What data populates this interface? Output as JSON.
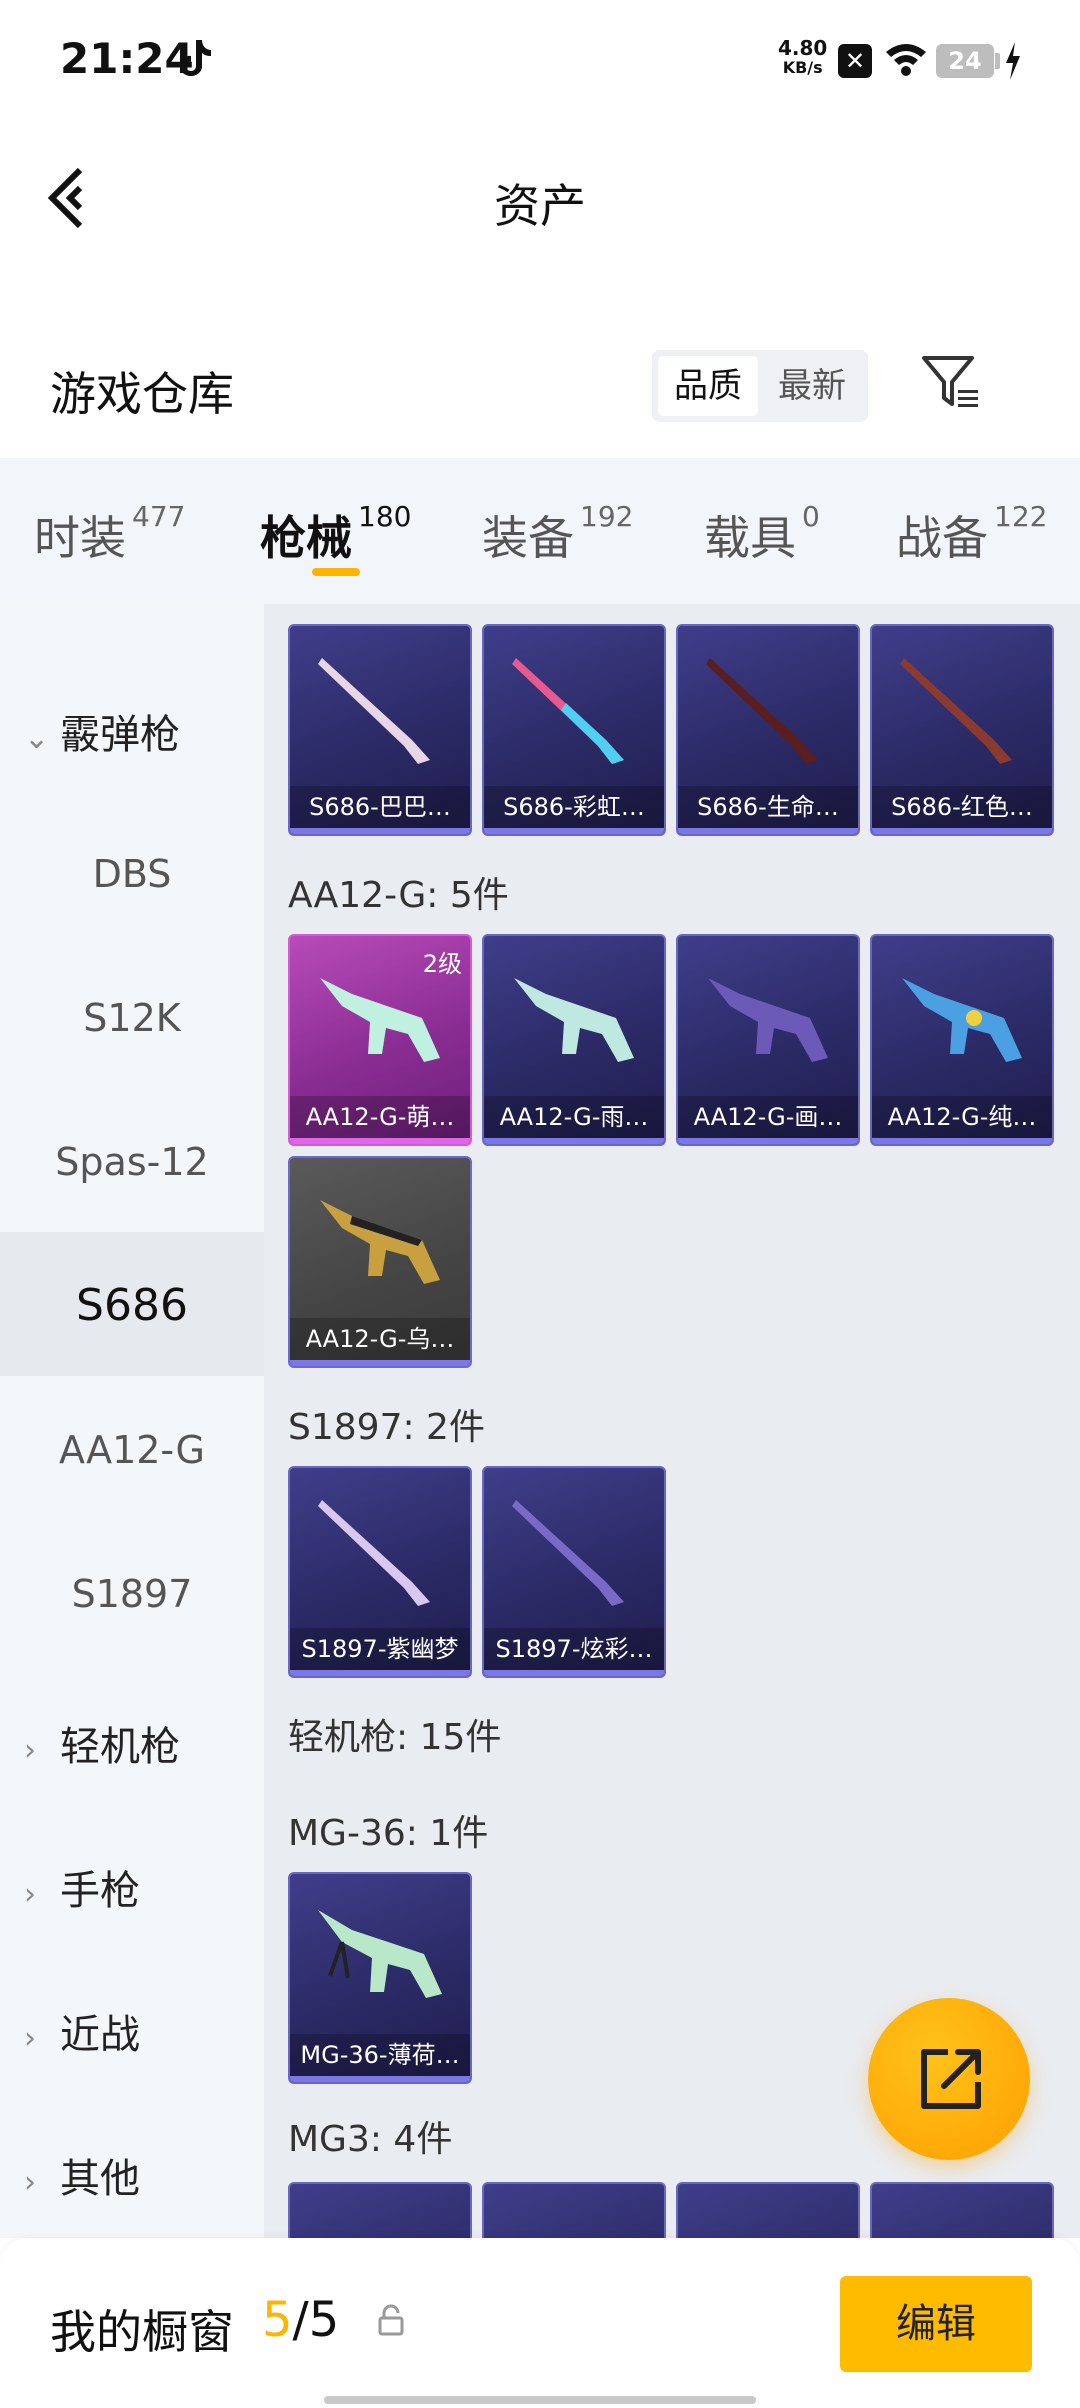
{
  "status_bar": {
    "time": "21:24",
    "net_speed_value": "4.80",
    "net_speed_unit": "KB/s",
    "battery": "24",
    "icons": [
      "tiktok-icon",
      "close-box-icon",
      "wifi-icon",
      "battery-icon",
      "charging-icon"
    ]
  },
  "header": {
    "title": "资产",
    "back_icon": "chevron-left-icon"
  },
  "section": {
    "title": "游戏仓库",
    "sort_options": [
      "品质",
      "最新"
    ],
    "sort_selected": "品质",
    "filter_icon": "filter-icon"
  },
  "tabs": [
    {
      "label": "时装",
      "count": "477"
    },
    {
      "label": "枪械",
      "count": "180",
      "active": true
    },
    {
      "label": "装备",
      "count": "192"
    },
    {
      "label": "载具",
      "count": "0"
    },
    {
      "label": "战备",
      "count": "122"
    }
  ],
  "left_nav": {
    "group_shotgun": "霰弹枪",
    "items": [
      "DBS",
      "S12K",
      "Spas-12",
      "S686",
      "AA12-G",
      "S1897"
    ],
    "active_item": "S686",
    "groups_collapsed": [
      "轻机枪",
      "手枪",
      "近战",
      "其他"
    ]
  },
  "content": {
    "row_s686": [
      {
        "name": "S686-巴巴…"
      },
      {
        "name": "S686-彩虹…"
      },
      {
        "name": "S686-生命…"
      },
      {
        "name": "S686-红色…"
      }
    ],
    "group_aa12": "AA12-G: 5件",
    "row_aa12": [
      {
        "name": "AA12-G-萌…",
        "level": "2级"
      },
      {
        "name": "AA12-G-雨…"
      },
      {
        "name": "AA12-G-画…"
      },
      {
        "name": "AA12-G-纯…"
      },
      {
        "name": "AA12-G-乌…"
      }
    ],
    "group_s1897": "S1897: 2件",
    "row_s1897": [
      {
        "name": "S1897-紫幽梦"
      },
      {
        "name": "S1897-炫彩…"
      }
    ],
    "group_lmg": "轻机枪: 15件",
    "group_mg36": "MG-36: 1件",
    "row_mg36": [
      {
        "name": "MG-36-薄荷…"
      }
    ],
    "group_mg3": "MG3: 4件"
  },
  "fab": {
    "icon": "share-export-icon"
  },
  "bottom_bar": {
    "label": "我的橱窗",
    "current": "5",
    "separator": "/",
    "total": "5",
    "lock_icon": "lock-icon",
    "edit_label": "编辑"
  },
  "colors": {
    "accent": "#ffb400",
    "card_purple": "#2b2a66",
    "card_pink": "#8a2d93",
    "card_gray": "#444444"
  }
}
